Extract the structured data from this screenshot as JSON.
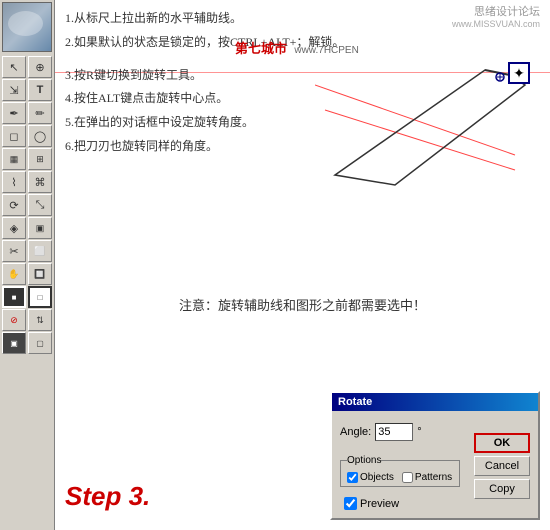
{
  "watermark": {
    "line1": "思绪设计论坛",
    "line2": "www.MISSVUAN.com"
  },
  "instructions": [
    "1.从标尺上拉出新的水平辅助线。",
    "2.如果默认的状态是锁定的，按CTRL+ALT+；解锁。",
    "3.按R键切换到旋转工具。",
    "4.按住ALT键点击旋转中心点。",
    "5.在弹出的对话框中设定旋转角度。",
    "6.把刀刃也旋转同样的角度。"
  ],
  "overlay_text": {
    "city": "第七城市",
    "url": "www.7HCPEN"
  },
  "note": "注意：旋转辅助线和图形之前都需要选中！",
  "step_label": "Step 3.",
  "dialog": {
    "title": "Rotate",
    "angle_label": "Angle:",
    "angle_value": "35",
    "degree": "°",
    "ok_label": "OK",
    "cancel_label": "Cancel",
    "copy_label": "Copy",
    "options_title": "Options",
    "objects_label": "Objects",
    "patterns_label": "Patterns",
    "preview_label": "Preview"
  },
  "toolbar": {
    "tools": [
      {
        "icon": "↖",
        "name": "arrow"
      },
      {
        "icon": "⊕",
        "name": "zoom"
      },
      {
        "icon": "⇲",
        "name": "select"
      },
      {
        "icon": "T",
        "name": "type"
      },
      {
        "icon": "✏",
        "name": "pen"
      },
      {
        "icon": "◻",
        "name": "rect"
      },
      {
        "icon": "⊞",
        "name": "grid"
      },
      {
        "icon": "⌇",
        "name": "brush"
      },
      {
        "icon": "⟲",
        "name": "rotate"
      },
      {
        "icon": "◈",
        "name": "blend"
      },
      {
        "icon": "✂",
        "name": "scissors"
      },
      {
        "icon": "◑",
        "name": "fill"
      },
      {
        "icon": "⬛",
        "name": "color"
      }
    ]
  }
}
